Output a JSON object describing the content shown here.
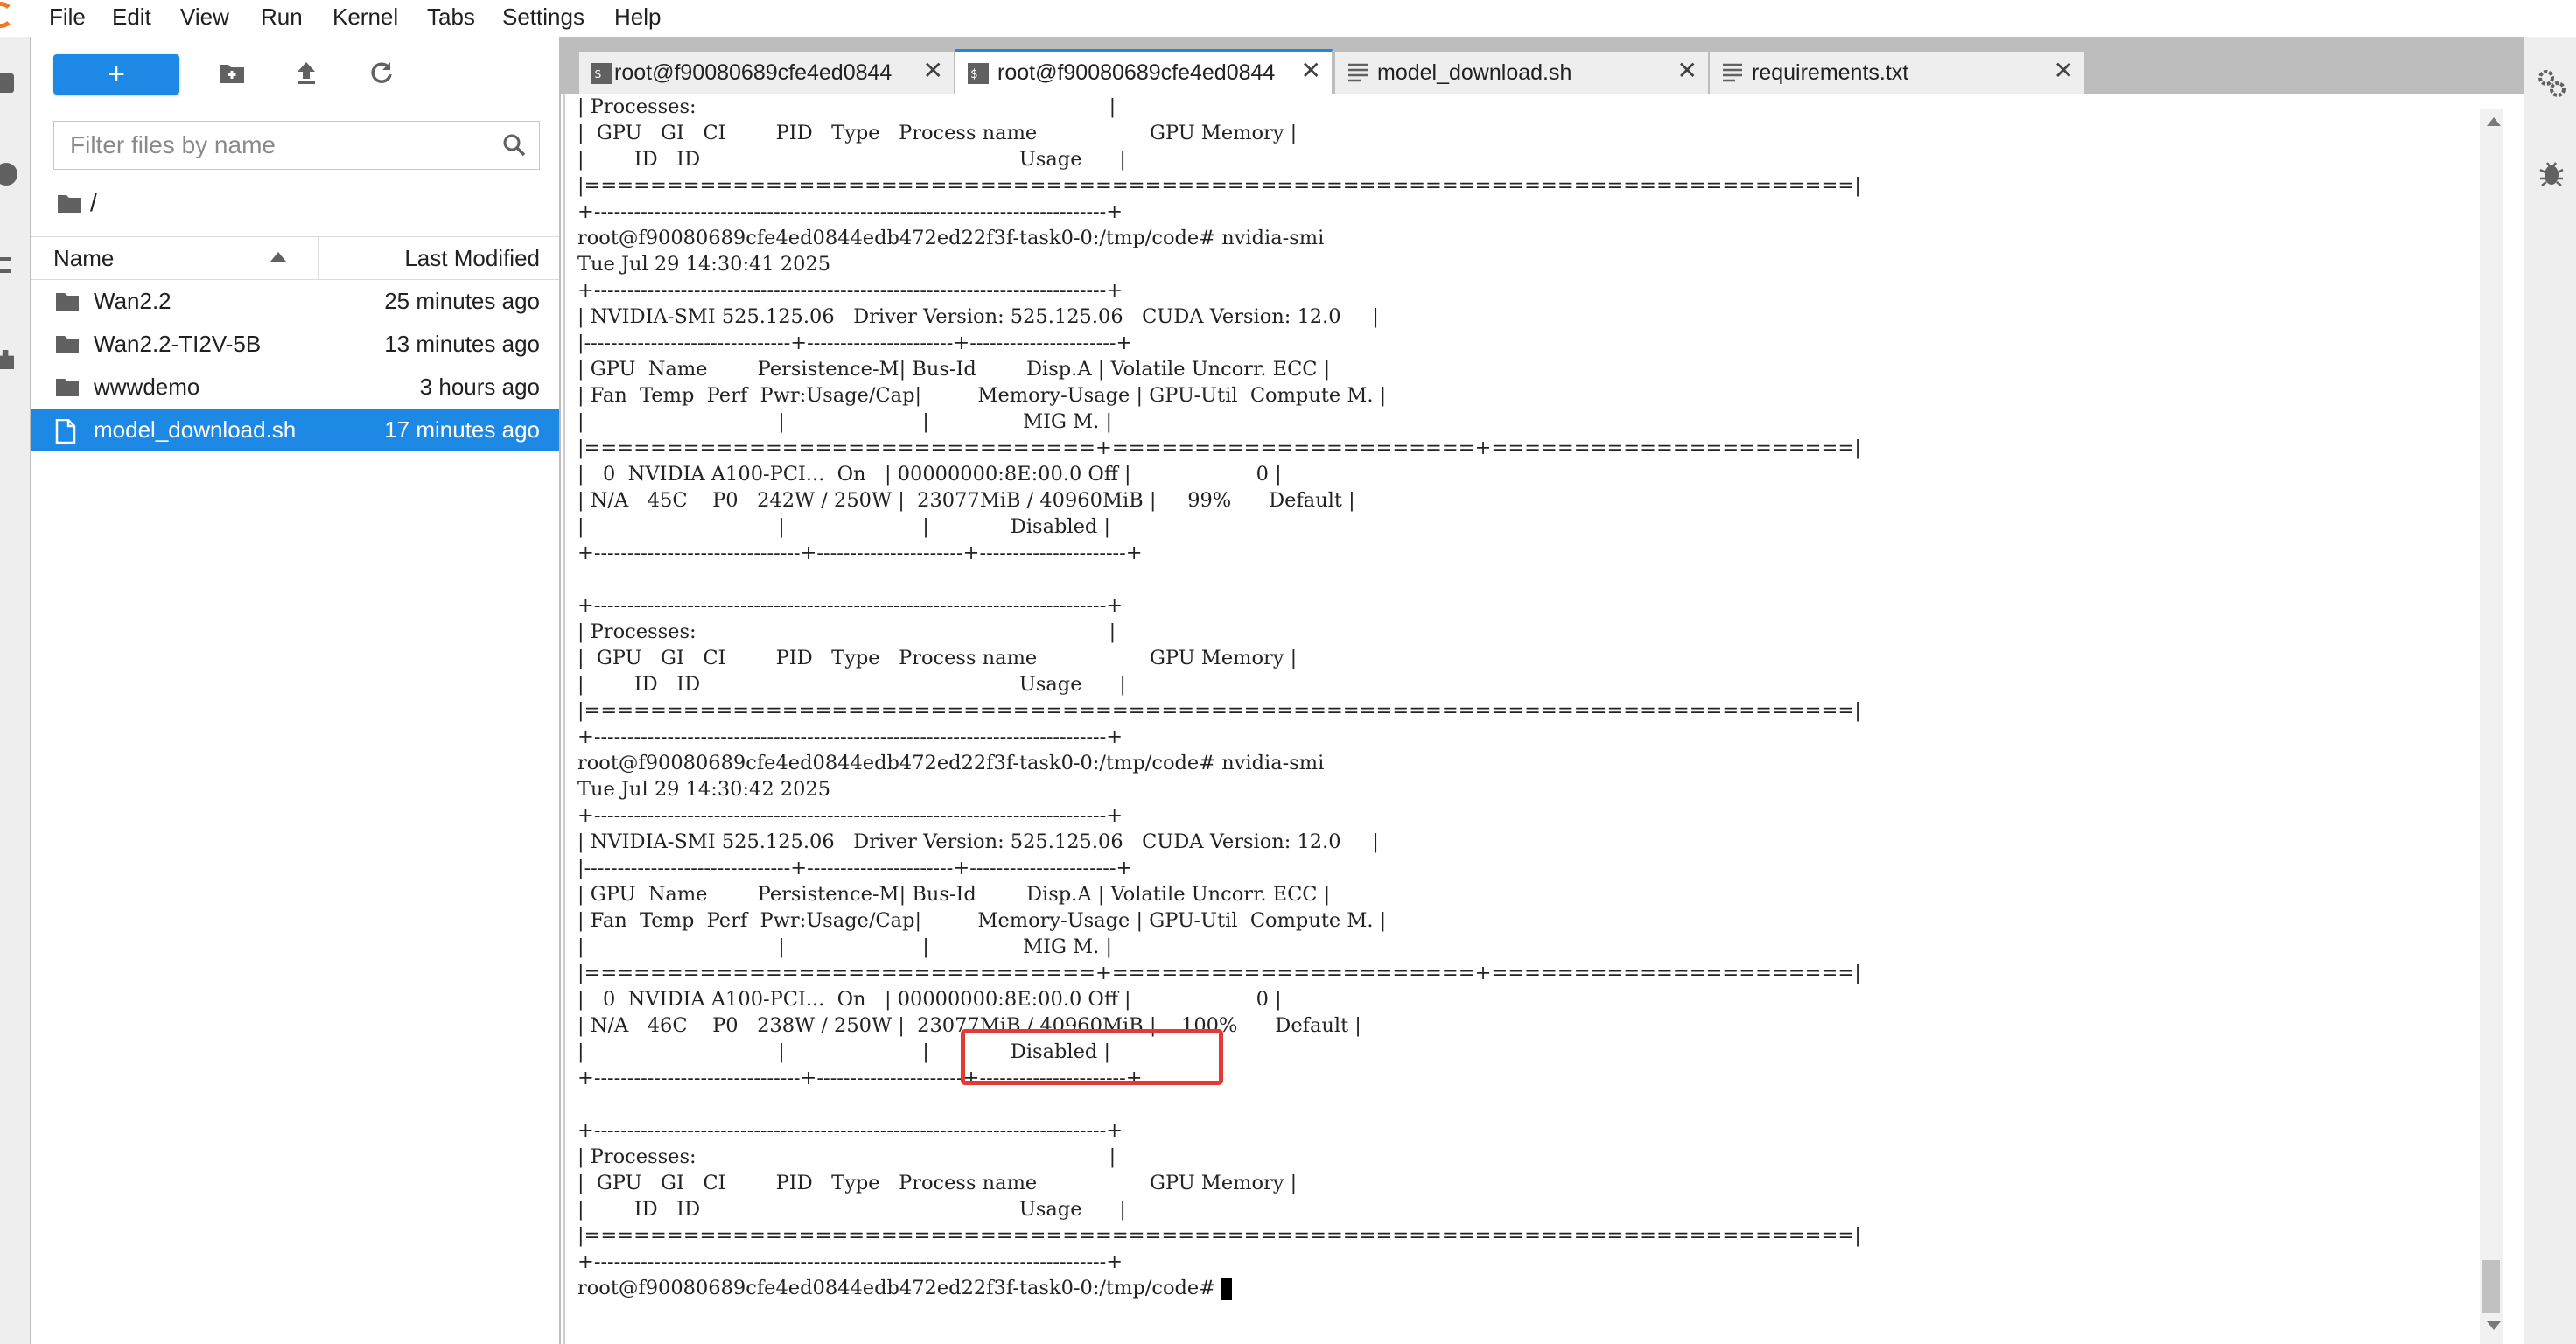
{
  "menu": [
    "File",
    "Edit",
    "View",
    "Run",
    "Kernel",
    "Tabs",
    "Settings",
    "Help"
  ],
  "filebrowser": {
    "new_label": "+",
    "filter_placeholder": "Filter files by name",
    "breadcrumb": "/",
    "col_name": "Name",
    "col_modified": "Last Modified",
    "files": [
      {
        "name": "Wan2.2",
        "modified": "25 minutes ago",
        "type": "folder"
      },
      {
        "name": "Wan2.2-TI2V-5B",
        "modified": "13 minutes ago",
        "type": "folder"
      },
      {
        "name": "wwwdemo",
        "modified": "3 hours ago",
        "type": "folder"
      },
      {
        "name": "model_download.sh",
        "modified": "17 minutes ago",
        "type": "file",
        "selected": true
      }
    ]
  },
  "tabs": [
    {
      "label": "root@f90080689cfe4ed0844",
      "icon": "terminal-icon",
      "active": false
    },
    {
      "label": "root@f90080689cfe4ed0844",
      "icon": "terminal-icon",
      "active": true
    },
    {
      "label": "model_download.sh",
      "icon": "text-file-icon",
      "active": false
    },
    {
      "label": "requirements.txt",
      "icon": "text-file-icon",
      "active": false
    }
  ],
  "terminal": {
    "lines": [
      "| Processes:                                                                  |",
      "|  GPU   GI   CI        PID   Type   Process name                  GPU Memory |",
      "|        ID   ID                                                   Usage      |",
      "|=============================================================================|",
      "+-----------------------------------------------------------------------------+",
      "root@f90080689cfe4ed0844edb472ed22f3f-task0-0:/tmp/code# nvidia-smi",
      "Tue Jul 29 14:30:41 2025",
      "+-----------------------------------------------------------------------------+",
      "| NVIDIA-SMI 525.125.06   Driver Version: 525.125.06   CUDA Version: 12.0     |",
      "|-------------------------------+----------------------+----------------------+",
      "| GPU  Name        Persistence-M| Bus-Id        Disp.A | Volatile Uncorr. ECC |",
      "| Fan  Temp  Perf  Pwr:Usage/Cap|         Memory-Usage | GPU-Util  Compute M. |",
      "|                               |                      |               MIG M. |",
      "|===============================+======================+======================|",
      "|   0  NVIDIA A100-PCI...  On   | 00000000:8E:00.0 Off |                    0 |",
      "| N/A   45C    P0   242W / 250W |  23077MiB / 40960MiB |     99%      Default |",
      "|                               |                      |             Disabled |",
      "+-------------------------------+----------------------+----------------------+",
      "",
      "+-----------------------------------------------------------------------------+",
      "| Processes:                                                                  |",
      "|  GPU   GI   CI        PID   Type   Process name                  GPU Memory |",
      "|        ID   ID                                                   Usage      |",
      "|=============================================================================|",
      "+-----------------------------------------------------------------------------+",
      "root@f90080689cfe4ed0844edb472ed22f3f-task0-0:/tmp/code# nvidia-smi",
      "Tue Jul 29 14:30:42 2025",
      "+-----------------------------------------------------------------------------+",
      "| NVIDIA-SMI 525.125.06   Driver Version: 525.125.06   CUDA Version: 12.0     |",
      "|-------------------------------+----------------------+----------------------+",
      "| GPU  Name        Persistence-M| Bus-Id        Disp.A | Volatile Uncorr. ECC |",
      "| Fan  Temp  Perf  Pwr:Usage/Cap|         Memory-Usage | GPU-Util  Compute M. |",
      "|                               |                      |               MIG M. |",
      "|===============================+======================+======================|",
      "|   0  NVIDIA A100-PCI...  On   | 00000000:8E:00.0 Off |                    0 |",
      "| N/A   46C    P0   238W / 250W |  23077MiB / 40960MiB |    100%      Default |",
      "|                               |                      |             Disabled |",
      "+-------------------------------+----------------------+----------------------+",
      "",
      "+-----------------------------------------------------------------------------+",
      "| Processes:                                                                  |",
      "|  GPU   GI   CI        PID   Type   Process name                  GPU Memory |",
      "|        ID   ID                                                   Usage      |",
      "|=============================================================================|",
      "+-----------------------------------------------------------------------------+"
    ],
    "prompt": "root@f90080689cfe4ed0844edb472ed22f3f-task0-0:/tmp/code# "
  },
  "colors": {
    "accent": "#1e88e5",
    "highlight": "#e53935",
    "jupyter_orange": "#f37726"
  }
}
